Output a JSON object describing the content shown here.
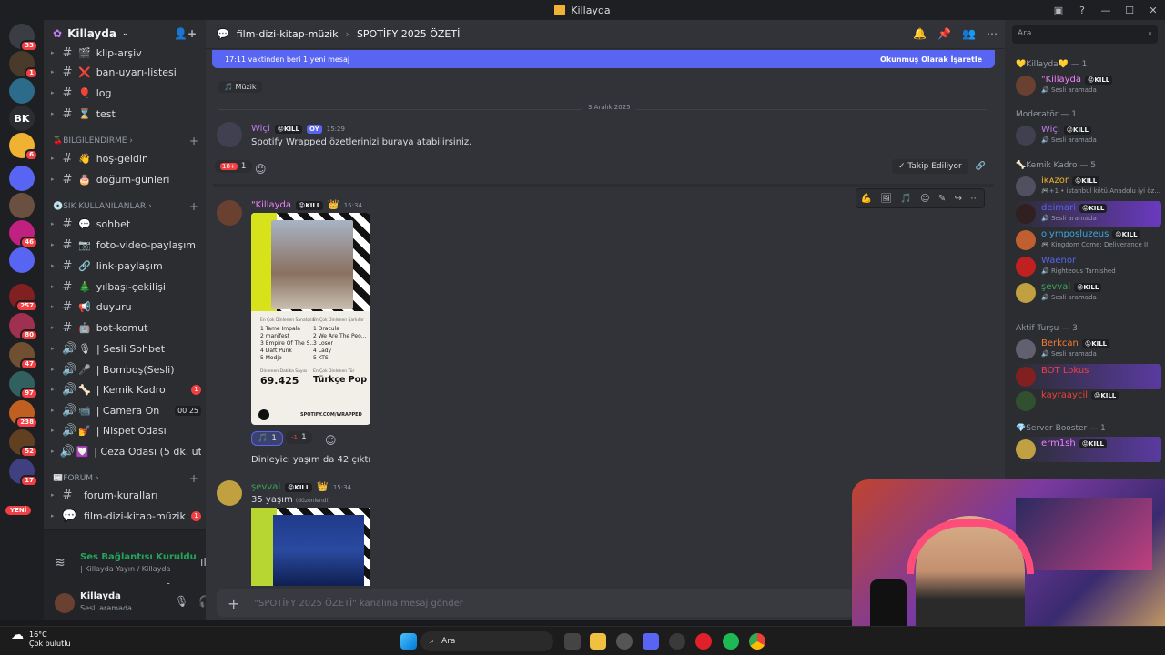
{
  "window": {
    "title": "Killayda"
  },
  "servers": [
    {
      "label": "",
      "badge": "33",
      "color": "#3b3d44"
    },
    {
      "label": "",
      "badge": "1",
      "color": "#4a3a2a"
    },
    {
      "label": "",
      "badge": "",
      "color": "#2d6b8a"
    },
    {
      "label": "BK",
      "badge": "",
      "color": "#2b2d31"
    },
    {
      "label": "",
      "badge": "6",
      "color": "#f0b232"
    },
    {
      "label": "",
      "badge": "",
      "color": "#5865f2"
    },
    {
      "label": "",
      "badge": "",
      "color": "#6a5040"
    },
    {
      "label": "",
      "badge": "46",
      "color": "#c02080"
    },
    {
      "label": "",
      "badge": "",
      "color": "#5865f2"
    },
    {
      "label": "",
      "badge": "257",
      "color": "#802020"
    },
    {
      "label": "",
      "badge": "80",
      "color": "#a03050"
    },
    {
      "label": "",
      "badge": "47",
      "color": "#705030"
    },
    {
      "label": "",
      "badge": "97",
      "color": "#306060"
    },
    {
      "label": "",
      "badge": "238",
      "color": "#c06020"
    },
    {
      "label": "",
      "badge": "52",
      "color": "#604020"
    },
    {
      "label": "",
      "badge": "17",
      "color": "#404080"
    }
  ],
  "servers_new": "YENİ",
  "guild": {
    "name": "Killayda"
  },
  "channels": [
    {
      "name": "klip-arşiv",
      "icon": "#",
      "emoji": "🎬"
    },
    {
      "name": "ban-uyarı-listesi",
      "icon": "#",
      "emoji": "❌"
    },
    {
      "name": "log",
      "icon": "#",
      "emoji": "🎈"
    },
    {
      "name": "test",
      "icon": "#",
      "emoji": "⌛"
    }
  ],
  "cat1": "🍒BİLGİLENDİRME",
  "channels2": [
    {
      "name": "hoş-geldin",
      "icon": "#",
      "emoji": "👋"
    },
    {
      "name": "doğum-günleri",
      "icon": "#",
      "emoji": "🎂"
    }
  ],
  "cat2": "💿SIK KULLANILANLAR",
  "channels3": [
    {
      "name": "sohbet",
      "icon": "#",
      "emoji": "💬",
      "count": "",
      "voice": ""
    },
    {
      "name": "foto-video-paylaşım",
      "icon": "#",
      "emoji": "📷",
      "count": "",
      "voice": ""
    },
    {
      "name": "link-paylaşım",
      "icon": "#",
      "emoji": "🔗",
      "count": "",
      "voice": ""
    },
    {
      "name": "yılbaşı-çekilişi",
      "icon": "#",
      "emoji": "🎄",
      "count": "",
      "voice": ""
    },
    {
      "name": "duyuru",
      "icon": "#",
      "emoji": "📢",
      "count": "",
      "voice": ""
    },
    {
      "name": "bot-komut",
      "icon": "#",
      "emoji": "🤖",
      "count": "",
      "voice": ""
    },
    {
      "name": "| Sesli Sohbet",
      "icon": "🔊",
      "emoji": "🎙",
      "count": "",
      "voice": ""
    },
    {
      "name": "| Bomboş(Sesli)",
      "icon": "🔊",
      "emoji": "🎤",
      "count": "",
      "voice": ""
    },
    {
      "name": "| Kemik Kadro",
      "icon": "🔊",
      "emoji": "🦴",
      "count": "1",
      "voice": ""
    },
    {
      "name": "| Camera On",
      "icon": "🔊",
      "emoji": "📹",
      "count": "",
      "voice": "00  25"
    },
    {
      "name": "| Nispet Odası",
      "icon": "🔊",
      "emoji": "💅",
      "count": "",
      "voice": ""
    },
    {
      "name": "| Ceza Odası (5 dk. utan...",
      "icon": "🔊",
      "emoji": "💟",
      "count": "",
      "voice": ""
    }
  ],
  "cat3": "📰FORUM",
  "channels4": [
    {
      "name": "forum-kuralları",
      "icon": "#",
      "emoji": "",
      "count": ""
    },
    {
      "name": "film-dizi-kitap-müzik",
      "icon": "💬",
      "emoji": "",
      "count": "1"
    }
  ],
  "voice": {
    "status": "Ses Bağlantısı Kuruldu",
    "sub": "| Killayda Yayın / Killayda"
  },
  "user": {
    "name": "Killayda",
    "status": "Sesli aramada"
  },
  "header": {
    "parent": "film-dizi-kitap-müzik",
    "thread": "SPOTİFY 2025 ÖZETİ"
  },
  "newbar": {
    "text": "17:11 vaktinden beri 1 yeni mesaj",
    "action": "Okunmuş Olarak İşaretle"
  },
  "tag": "🎵 Müzik",
  "date": "3 Aralık 2025",
  "messages": [
    {
      "author": "Wiçi",
      "color": "#c27cf0",
      "badge": "😡KILL",
      "extra": "OY",
      "time": "15:29",
      "text": "Spotify Wrapped özetlerinizi buraya atabilirsiniz."
    },
    {
      "author": "\"Killayda",
      "color": "#f47fff",
      "badge": "😡KILL",
      "time": "15:34",
      "text": "Dinleyici yaşım da 42 çıktı"
    },
    {
      "author": "şevval",
      "color": "#3ba55d",
      "badge": "😡KILL",
      "time": "15:34",
      "text": "35 yaşım",
      "edited": "(düzenlendi)"
    }
  ],
  "reactions1": [
    {
      "emoji": "18+",
      "count": "1"
    }
  ],
  "reactions2": [
    {
      "emoji": "🎵",
      "count": "1"
    },
    {
      "emoji": "-1",
      "count": "1"
    }
  ],
  "follow": "✓ Takip Ediliyor",
  "wrapped": {
    "artists_h": "En Çok Dinlenen Sanatçılar",
    "songs_h": "En Çok Dinlenen Şarkılar",
    "artists": [
      "1  Tame Impala",
      "2  manifest",
      "3  Empire Of The S...",
      "4  Daft Punk",
      "5  Modjo"
    ],
    "songs": [
      "1  Dracula",
      "2  We Are The Peo...",
      "3  Loser",
      "4  Lady",
      "5  KTS"
    ],
    "minutes_h": "Dinlenen Dakika Sayısı",
    "minutes": "69.425",
    "genre_h": "En Çok Dinlenen Tür",
    "genre": "Türkçe Pop",
    "url": "SPOTIFY.COM/WRAPPED"
  },
  "input": {
    "placeholder": "\"SPOTİFY 2025 ÖZETİ\" kanalına mesaj gönder"
  },
  "member_search": "Ara",
  "member_groups": [
    {
      "title": "💛Killayda💛 — 1",
      "members": [
        {
          "name": "\"Killayda",
          "color": "#f47fff",
          "badge": "😡KILL",
          "sub": "🔊 Sesli aramada",
          "av": "#6a4030"
        }
      ]
    },
    {
      "title": "Moderatör — 1",
      "members": [
        {
          "name": "Wiçi",
          "color": "#c27cf0",
          "badge": "😡KILL",
          "sub": "🔊 Sesli aramada",
          "av": "#404050"
        }
      ]
    },
    {
      "title": "🦴Kemik Kadro — 5",
      "members": [
        {
          "name": "iᴋᴀzor",
          "color": "#f0b232",
          "badge": "😡KILL",
          "sub": "🎮+1 • istanbul kötü Anadolu iyi öz...",
          "av": "#505060"
        },
        {
          "name": "deimari",
          "color": "#5865f2",
          "badge": "😡KILL",
          "sub": "🔊 Sesli aramada",
          "av": "#302020"
        },
        {
          "name": "olymposluzeus",
          "color": "#3ba5e5",
          "badge": "😡KILL",
          "sub": "🎮 Kingdom Come: Deliverance II",
          "av": "#c06030"
        },
        {
          "name": "Waenor",
          "color": "#5865f2",
          "badge": "",
          "sub": "🔊 Righteous Tarnished",
          "av": "#c02020"
        },
        {
          "name": "şevval",
          "color": "#3ba55d",
          "badge": "😡KILL",
          "sub": "🔊 Sesli aramada",
          "av": "#c0a040"
        }
      ]
    },
    {
      "title": "Aktif Turşu — 3",
      "members": [
        {
          "name": "Berkcan",
          "color": "#f47b30",
          "badge": "😡KILL",
          "sub": "🔊 Sesli aramada",
          "av": "#606070"
        },
        {
          "name": "BOT Lokus",
          "color": "#f23f43",
          "badge": "",
          "sub": "",
          "av": "#802020"
        },
        {
          "name": "kayraaycil",
          "color": "#f23f43",
          "badge": "😡KILL",
          "sub": "",
          "av": "#305030"
        }
      ]
    },
    {
      "title": "💎Server Booster — 1",
      "members": [
        {
          "name": "erm1sh",
          "color": "#f47fff",
          "badge": "😡KILL",
          "sub": "",
          "av": "#c0a040"
        }
      ]
    }
  ],
  "taskbar": {
    "temp": "16°C",
    "weather": "Çok bulutlu",
    "search": "Ara"
  }
}
